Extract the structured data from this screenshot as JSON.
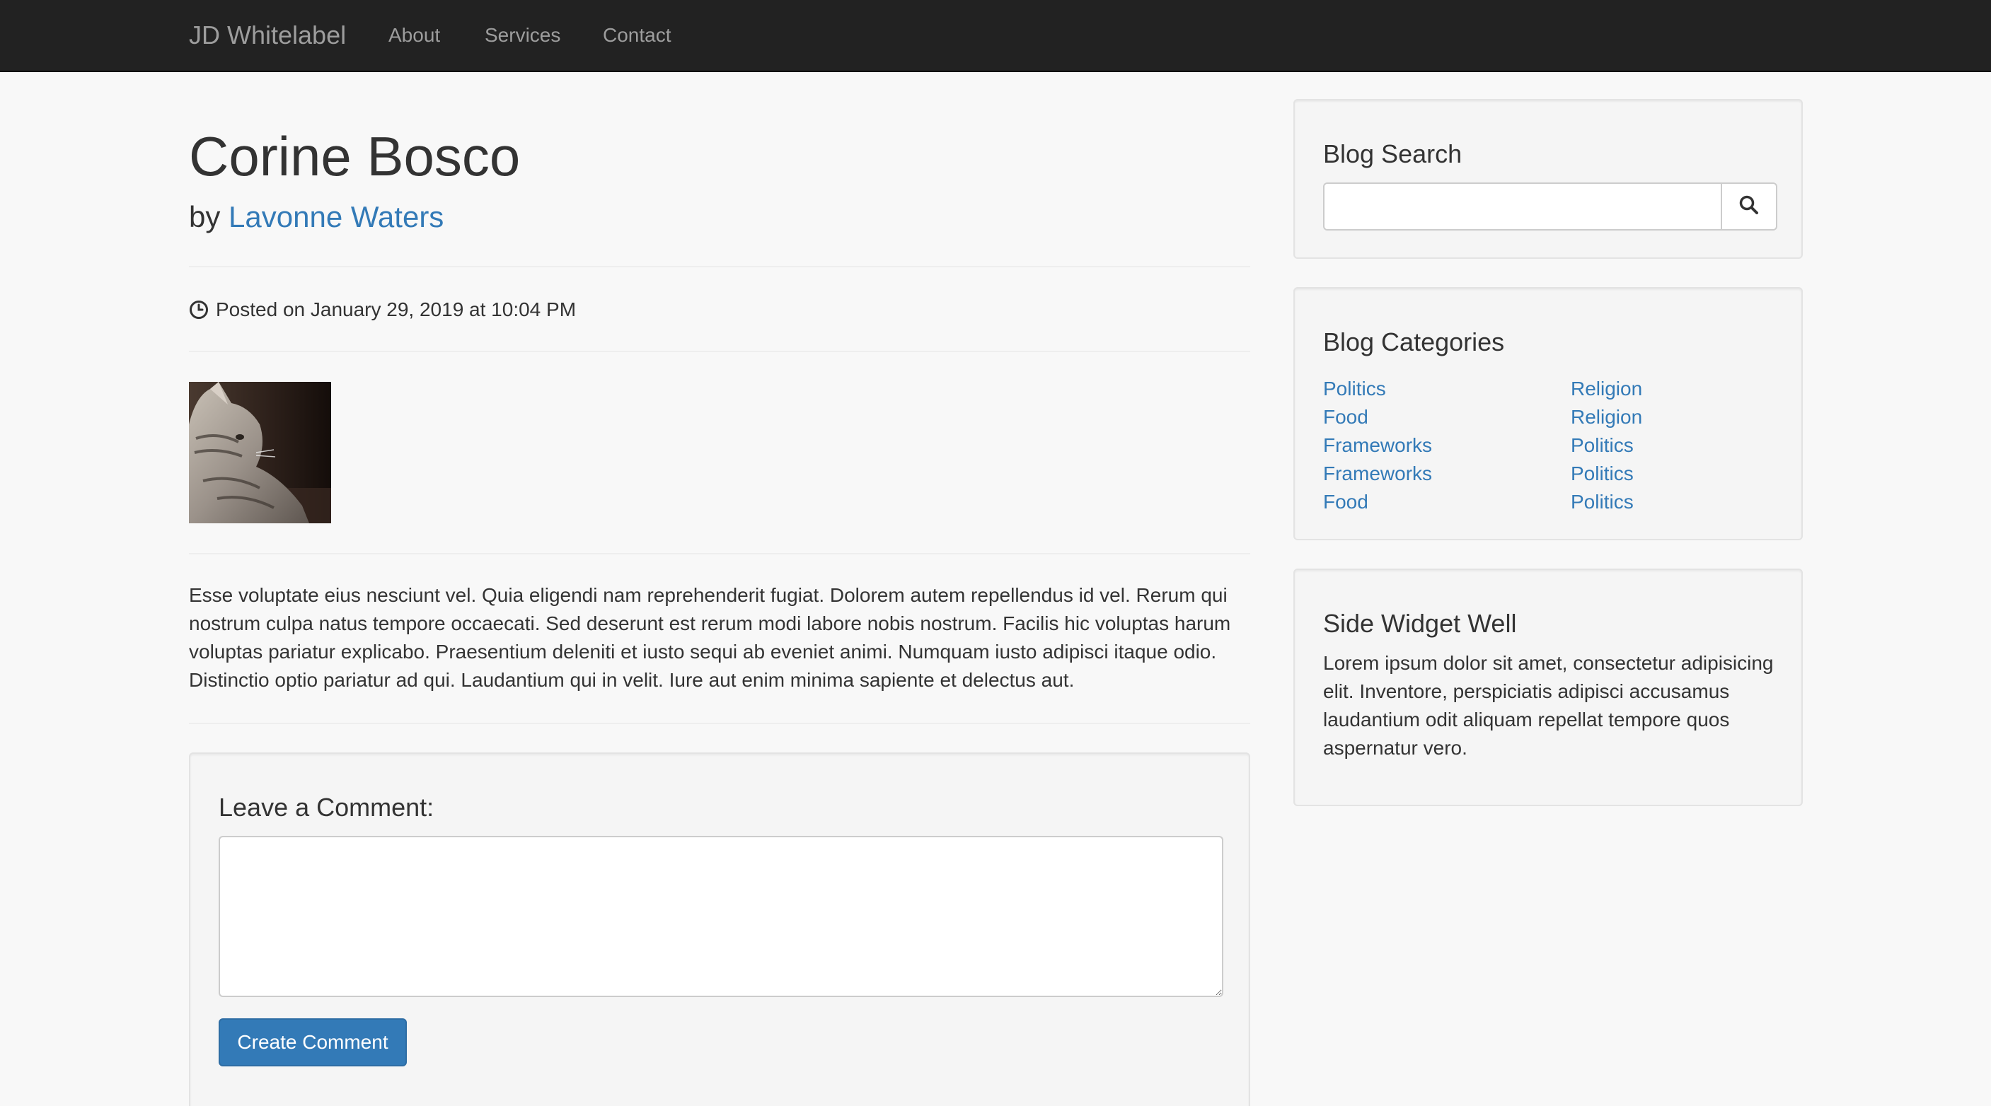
{
  "navbar": {
    "brand": "JD Whitelabel",
    "links": [
      "About",
      "Services",
      "Contact"
    ]
  },
  "post": {
    "title": "Corine Bosco",
    "by_prefix": "by",
    "author": "Lavonne Waters",
    "posted": "Posted on January 29, 2019 at 10:04 PM",
    "image_alt": "cat photo",
    "body": "Esse voluptate eius nesciunt vel. Quia eligendi nam reprehenderit fugiat. Dolorem autem repellendus id vel. Rerum qui nostrum culpa natus tempore occaecati. Sed deserunt est rerum modi labore nobis nostrum. Facilis hic voluptas harum voluptas pariatur explicabo. Praesentium deleniti et iusto sequi ab eveniet animi. Numquam iusto adipisci itaque odio. Distinctio optio pariatur ad qui. Laudantium qui in velit. Iure aut enim minima sapiente et delectus aut."
  },
  "comment": {
    "heading": "Leave a Comment:",
    "textarea_value": "",
    "submit_label": "Create Comment"
  },
  "sidebar": {
    "search": {
      "title": "Blog Search",
      "input_value": "",
      "button_icon": "search-icon"
    },
    "categories": {
      "title": "Blog Categories",
      "left": [
        "Politics",
        "Food",
        "Frameworks",
        "Frameworks",
        "Food"
      ],
      "right": [
        "Religion",
        "Religion",
        "Politics",
        "Politics",
        "Politics"
      ]
    },
    "widget": {
      "title": "Side Widget Well",
      "text": "Lorem ipsum dolor sit amet, consectetur adipisicing elit. Inventore, perspiciatis adipisci accusamus laudantium odit aliquam repellat tempore quos aspernatur vero."
    }
  },
  "colors": {
    "navbar_bg": "#222222",
    "link": "#337ab7",
    "primary_button": "#337ab7",
    "page_bg": "#f8f8f8",
    "well_bg": "#f5f5f5"
  }
}
